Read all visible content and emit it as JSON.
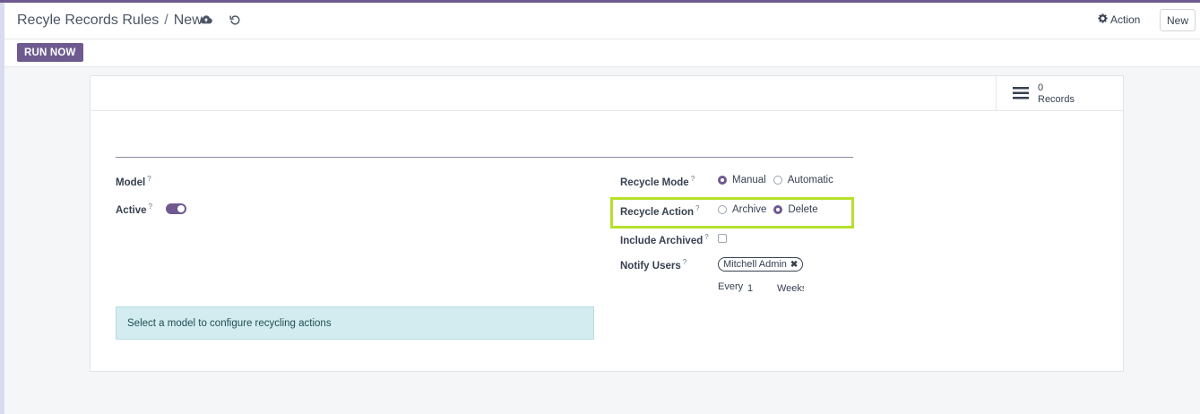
{
  "header": {
    "breadcrumb_root": "Recyle Records Rules",
    "breadcrumb_separator": "/",
    "breadcrumb_current": "New",
    "action_label": "Action",
    "new_label": "New"
  },
  "subbar": {
    "run_now_label": "RUN NOW"
  },
  "stat": {
    "count": "0",
    "label": "Records"
  },
  "form": {
    "model_label": "Model",
    "active_label": "Active",
    "help_mark": "?",
    "recycle_mode_label": "Recycle Mode",
    "recycle_mode_options": [
      "Manual",
      "Automatic"
    ],
    "recycle_action_label": "Recycle Action",
    "recycle_action_options": [
      "Archive",
      "Delete"
    ],
    "include_archived_label": "Include Archived",
    "notify_users_label": "Notify Users",
    "notify_user_tag": "Mitchell Admin",
    "every_label": "Every",
    "every_value": "1",
    "period_value": "Weeks"
  },
  "alert": {
    "text": "Select a model to configure recycling actions"
  },
  "colors": {
    "accent": "#6e5a8f",
    "highlight": "#b5e02b",
    "alert_bg": "#d3ecef"
  }
}
